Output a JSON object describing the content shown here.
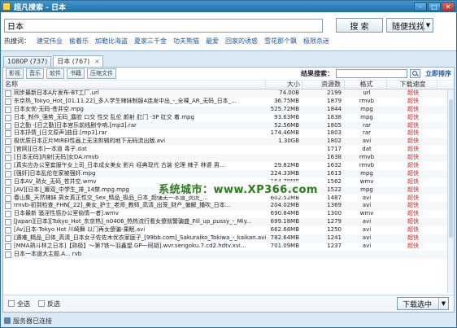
{
  "window": {
    "title": "超凡搜索 - 日本"
  },
  "search": {
    "query": "日本",
    "search_label": "搜  索",
    "random_label": "随便找找"
  },
  "hot": {
    "label": "热搜词：",
    "terms": [
      "建党伟业",
      "偷着乐",
      "加勒比海盗",
      "夏家三千金",
      "功夫熊猫",
      "最爱",
      "回家的诱惑",
      "雪花那个飘",
      "极限杀迷"
    ]
  },
  "tabs": [
    {
      "label": "1080P (737)",
      "active": false
    },
    {
      "label": "日本 (767)",
      "active": true
    }
  ],
  "filters": [
    "影视",
    "音乐",
    "软件",
    "书籍",
    "压缩文件"
  ],
  "result_search": {
    "label": "结果搜索：",
    "sort_label": "立即排序"
  },
  "columns": {
    "name": "名称",
    "size": "大小",
    "count": "资源数",
    "format": "格式",
    "speed": "下载速度"
  },
  "rows": [
    {
      "name": "同步最新日本A片发布-BT工厂.url",
      "size": "74.00B",
      "count": "2199",
      "format": "url",
      "speed": "超快"
    },
    {
      "name": "东京热_Tokyo_Hot_[01.11.22]_多人学生辣妹制服4连发中出_-_全裸_AR_无码_日本_...",
      "size": "36.75MB",
      "count": "1879",
      "format": "rmvb",
      "speed": "超快"
    },
    {
      "name": "日本女优-无码-苍井空.mpg",
      "size": "525.72MB",
      "count": "1844",
      "format": "mpg",
      "speed": "超快"
    },
    {
      "name": "日本_制作_强势_无码_露脸 口交 性交 乱伦 颜射 肛门 -3P 肛交 着.mpg",
      "size": "93.63MB",
      "count": "1838",
      "format": "mpg",
      "speed": "超快"
    },
    {
      "name": "日之勤 -[日之勤]日本官乐前线剧令响.[mp3].rar",
      "size": "52.56MB",
      "count": "1805",
      "format": "rar",
      "speed": "超快"
    },
    {
      "name": "日本抒情_[日文原声]曲目.[mp3].rar",
      "size": "174.46MB",
      "count": "1803",
      "format": "rar",
      "speed": "超快"
    },
    {
      "name": "极优质日本正片MIREI性画上无法剪辑的地下无码流出版.avi",
      "size": "1.30GB",
      "count": "1802",
      "format": "avi",
      "speed": "超快"
    },
    {
      "name": "[官网][日本]一本道 毒子.dat",
      "size": "",
      "count": "1717",
      "format": "dat",
      "speed": "超快"
    },
    {
      "name": "[日本无码]内射[无码]女DA.rmvb",
      "size": "",
      "count": "1638",
      "format": "rmvb",
      "speed": "超快"
    },
    {
      "name": "[真实应办公室套服午女上司_日本成女美女 影片 经典现代 古装 伦理 辣子 林婆 男...",
      "size": "29.82MB",
      "count": "1632",
      "format": "rmvb",
      "speed": "超快"
    },
    {
      "name": "[强奸]日本乱伦在家被强奸.mpg",
      "size": "224.33MB",
      "count": "1613",
      "format": "mpg",
      "speed": "超快"
    },
    {
      "name": "日本AV_熟女_无码_苍井空.wmv",
      "size": "164.78MB",
      "count": "1562",
      "format": "wmv",
      "speed": "超快"
    },
    {
      "name": "[AV][日本]_娜双_中学生_排_14禁.mpg.mpg",
      "size": "306.70MB",
      "count": "1522",
      "format": "mpg",
      "speed": "超快"
    },
    {
      "name": "春山集_天然辣妹 男女真正性交_Sex_精品_极品_日本_超强无一本道_虎虎_...",
      "size": "602.52MB",
      "count": "1487",
      "format": "avi",
      "speed": "超快"
    },
    {
      "name": "rmvb-初到检查_FHN[_22]_美女_护士_老师_教师_高清_出笼_财产_偏解_播吹_日本...",
      "size": "204.02MB",
      "count": "1369",
      "format": "avi",
      "speed": "超快"
    },
    {
      "name": "日本最新 骚淫性感办公室偷情一者].wmv",
      "size": "690.84MB",
      "count": "1300",
      "format": "wmv",
      "speed": "超快"
    },
    {
      "name": "[Japan][日本][Tokyo_Hot_东京热]_n0406_热热流行看女傻就警骗盛_Fill_up_pussy_-_Miy...",
      "size": "699.18MB",
      "count": "1279",
      "format": "avi",
      "speed": "超快"
    },
    {
      "name": "[Av]日本-Tokyo Hot 川崎舞 以门再女傻骗-果眠.avi",
      "size": "662.68MB",
      "count": "1250",
      "format": "avi",
      "speed": "超快"
    },
    {
      "name": "[遇难_精品_日体_高清_日本女子佐佐木优衣家庭子_[99bb.com]_Sakuraiko_Tokiwa_-_kaikan.avi",
      "size": "782.64MB",
      "count": "1241",
      "format": "avi",
      "speed": "超快"
    },
    {
      "name": "[MMA熟斗林之日本]【熟极】～第7铁～羽鑫望.GP一同胡].wvr.sengoku.7.cd2.hdtv.xvi...",
      "size": "701.09MB",
      "count": "1237",
      "format": "avi",
      "speed": "超快"
    },
    {
      "name": "日本一本道大主题.A... rvb",
      "size": "",
      "count": "",
      "format": "",
      "speed": ""
    }
  ],
  "watermark": "系统城市：www.XP366.com",
  "footer": {
    "select_all": "全选",
    "invert": "反选",
    "download": "下载选中"
  },
  "status": {
    "text": "服务器已连接"
  },
  "colors": {
    "speed": "#dd2222",
    "link": "#1a57a0",
    "title_bar": "#1f6fa8"
  }
}
